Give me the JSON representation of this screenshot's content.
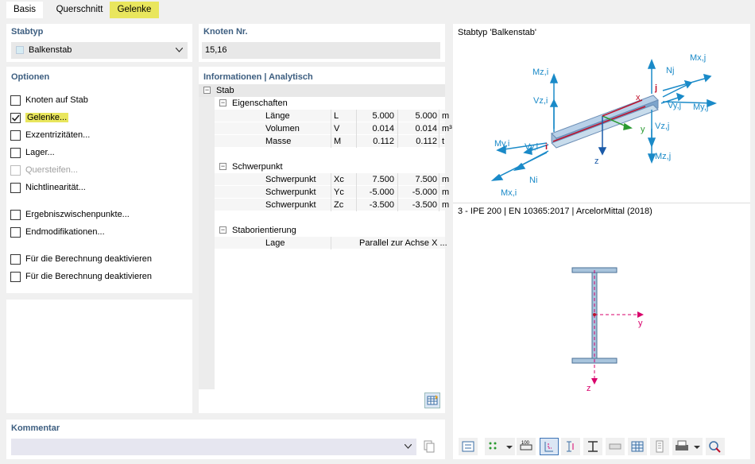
{
  "tabs": [
    {
      "label": "Basis"
    },
    {
      "label": "Querschnitt"
    },
    {
      "label": "Gelenke"
    }
  ],
  "stabtyp": {
    "title": "Stabtyp",
    "value": "Balkenstab"
  },
  "knoten": {
    "title": "Knoten Nr.",
    "value": "15,16"
  },
  "optionen": {
    "title": "Optionen",
    "items": [
      {
        "label": "Knoten auf Stab",
        "checked": false,
        "disabled": false
      },
      {
        "label": "Gelenke...",
        "checked": true,
        "disabled": false
      },
      {
        "label": "Exzentrizitäten...",
        "checked": false,
        "disabled": false
      },
      {
        "label": "Lager...",
        "checked": false,
        "disabled": false
      },
      {
        "label": "Quersteifen...",
        "checked": false,
        "disabled": true
      },
      {
        "label": "Nichtlinearität...",
        "checked": false,
        "disabled": false
      },
      {
        "label": "Ergebniszwischenpunkte...",
        "checked": false,
        "disabled": false
      },
      {
        "label": "Endmodifikationen...",
        "checked": false,
        "disabled": false
      },
      {
        "label": "Für die Berechnung deaktivieren",
        "checked": false,
        "disabled": false
      },
      {
        "label": "Für die Berechnung deaktivieren",
        "checked": false,
        "disabled": false
      }
    ]
  },
  "info": {
    "title": "Informationen | Analytisch",
    "root": "Stab",
    "eig": {
      "label": "Eigenschaften",
      "rows": [
        {
          "name": "Länge",
          "sym": "L",
          "v1": "5.000",
          "v2": "5.000",
          "unit": "m"
        },
        {
          "name": "Volumen",
          "sym": "V",
          "v1": "0.014",
          "v2": "0.014",
          "unit": "m³"
        },
        {
          "name": "Masse",
          "sym": "M",
          "v1": "0.112",
          "v2": "0.112",
          "unit": "t"
        }
      ]
    },
    "sch": {
      "label": "Schwerpunkt",
      "rows": [
        {
          "name": "Schwerpunkt",
          "sym": "Xc",
          "v1": "7.500",
          "v2": "7.500",
          "unit": "m"
        },
        {
          "name": "Schwerpunkt",
          "sym": "Yc",
          "v1": "-5.000",
          "v2": "-5.000",
          "unit": "m"
        },
        {
          "name": "Schwerpunkt",
          "sym": "Zc",
          "v1": "-3.500",
          "v2": "-3.500",
          "unit": "m"
        }
      ]
    },
    "ori": {
      "label": "Staborientierung",
      "rows": [
        {
          "name": "Lage",
          "value": "Parallel zur Achse X ..."
        }
      ]
    }
  },
  "kommentar": {
    "title": "Kommentar",
    "value": ""
  },
  "preview": {
    "title": "Stabtyp 'Balkenstab'",
    "section": "3 - IPE 200 | EN 10365:2017 | ArcelorMittal (2018)",
    "labels": {
      "mzi": "Mz,i",
      "vzi": "Vz,i",
      "myi": "My,i",
      "vyi": "Vy,i",
      "ni": "Ni",
      "mxi": "Mx,i",
      "nj": "Nj",
      "mxj": "Mx,j",
      "vyj": "Vy,j",
      "myj": "My,j",
      "vzj": "Vz,j",
      "mzj": "Mz,j",
      "x": "x",
      "y": "y",
      "z": "z",
      "i": "i",
      "j": "j"
    },
    "secy": "y",
    "secz": "z"
  },
  "colors": {
    "accent": "#3d5e80",
    "highlight": "#e9e65d",
    "force": "#1a8ac8",
    "axis": "#d8006b"
  }
}
